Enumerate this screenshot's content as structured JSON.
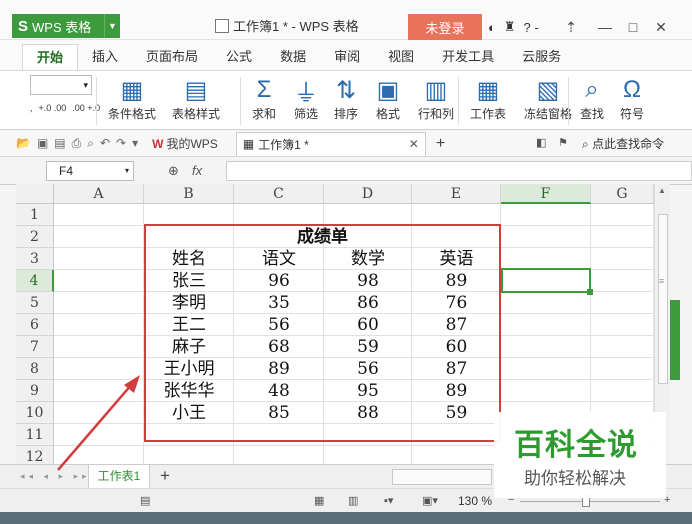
{
  "titlebar": {
    "app_logo": "S",
    "app_name": "WPS 表格",
    "doc_title": "工作簿1 * - WPS 表格",
    "login": "未登录",
    "tools": "? -",
    "minimize": "—",
    "restore": "□",
    "close": "✕"
  },
  "tabs": [
    "开始",
    "插入",
    "页面布局",
    "公式",
    "数据",
    "审阅",
    "视图",
    "开发工具",
    "云服务"
  ],
  "ribbon": {
    "font_size": "▾",
    "small_tools": [
      ",",
      "+.0 .00",
      ".00 +.0"
    ],
    "tools": [
      {
        "label": "条件格式",
        "icon": "conditional-format-icon"
      },
      {
        "label": "表格样式",
        "icon": "table-style-icon"
      },
      {
        "label": "求和",
        "icon": "sum-icon"
      },
      {
        "label": "筛选",
        "icon": "filter-icon"
      },
      {
        "label": "排序",
        "icon": "sort-icon"
      },
      {
        "label": "格式",
        "icon": "format-icon"
      },
      {
        "label": "行和列",
        "icon": "rows-columns-icon"
      },
      {
        "label": "工作表",
        "icon": "worksheet-icon"
      },
      {
        "label": "冻结窗格",
        "icon": "freeze-panes-icon"
      },
      {
        "label": "查找",
        "icon": "find-icon"
      },
      {
        "label": "符号",
        "icon": "symbol-icon"
      }
    ]
  },
  "docbar": {
    "wps_tab": "我的WPS",
    "doc_tab": "工作簿1 *",
    "find_cmd": "点此查找命令"
  },
  "formula": {
    "namebox": "F4",
    "fx": "fx",
    "value": ""
  },
  "grid": {
    "columns": [
      "A",
      "B",
      "C",
      "D",
      "E",
      "F",
      "G"
    ],
    "rows": [
      "1",
      "2",
      "3",
      "4",
      "5",
      "6",
      "7",
      "8",
      "9",
      "10",
      "11",
      "12"
    ],
    "selected_col": "F",
    "selected_row": "4",
    "table_title": "成绩单",
    "headers": [
      "姓名",
      "语文",
      "数学",
      "英语"
    ],
    "records": [
      [
        "张三",
        "96",
        "98",
        "89"
      ],
      [
        "李明",
        "35",
        "86",
        "76"
      ],
      [
        "王二",
        "56",
        "60",
        "87"
      ],
      [
        "麻子",
        "68",
        "59",
        "60"
      ],
      [
        "王小明",
        "89",
        "56",
        "87"
      ],
      [
        "张华华",
        "48",
        "95",
        "89"
      ],
      [
        "小王",
        "85",
        "88",
        "59"
      ]
    ]
  },
  "sheets": {
    "tabs": [
      "工作表1"
    ],
    "add": "+"
  },
  "status": {
    "zoom": "130 %",
    "zoom_minus": "−",
    "zoom_plus": "+"
  },
  "watermark": {
    "title": "百科全说",
    "subtitle": "助你轻松解决"
  },
  "colors": {
    "accent": "#3d9a3d",
    "highlight_box": "#d23c3c",
    "login": "#e8725a"
  }
}
